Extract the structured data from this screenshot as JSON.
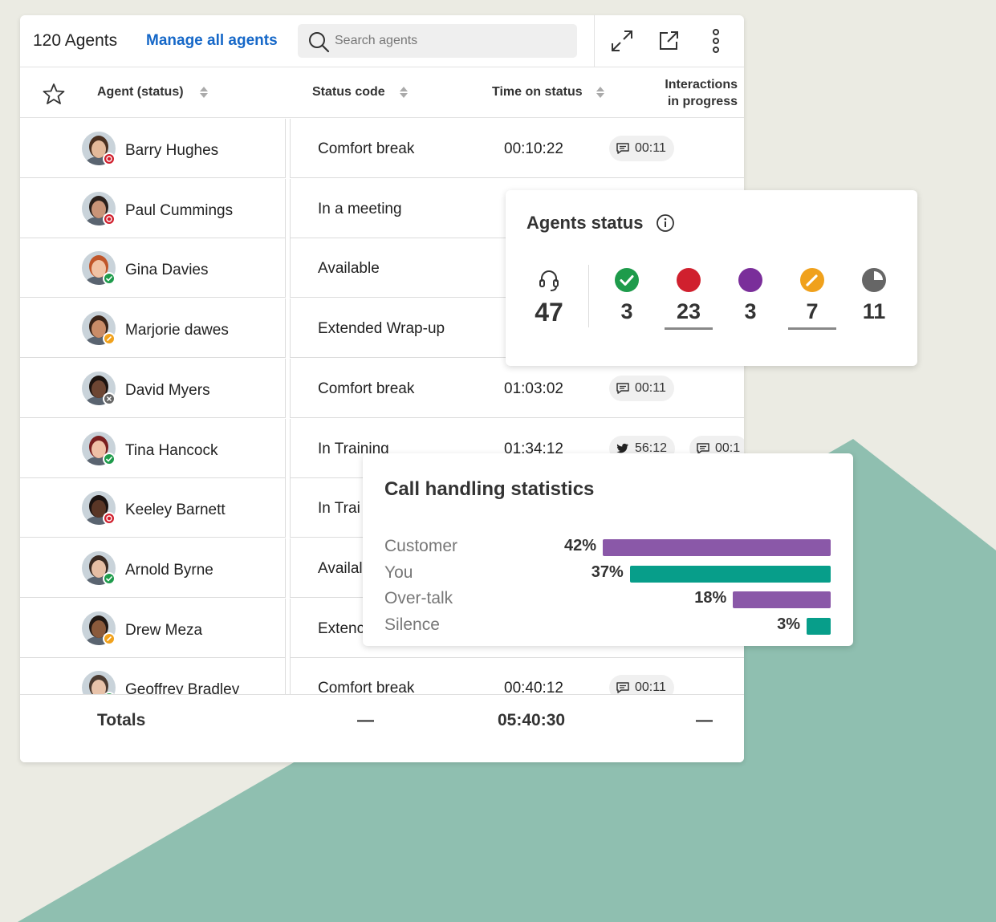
{
  "header": {
    "agent_count": "120 Agents",
    "manage_link": "Manage all agents",
    "search_placeholder": "Search agents"
  },
  "columns": {
    "agent": "Agent (status)",
    "status_code": "Status code",
    "time_on_status": "Time on status",
    "interactions_line1": "Interactions",
    "interactions_line2": "in progress"
  },
  "status_colors": {
    "busy": "#d0202e",
    "available": "#1e9b4b",
    "away": "#f0a11c",
    "offline": "#666666"
  },
  "rows": [
    {
      "name": "Barry Hughes",
      "status": "busy",
      "status_code": "Comfort break",
      "time": "00:10:22",
      "chip_icon": "chat-icon",
      "chip": "00:11",
      "skin": "#e3b99a",
      "hair": "#4a3020"
    },
    {
      "name": "Paul Cummings",
      "status": "busy",
      "status_code": "In a meeting",
      "time": "",
      "chip_icon": "",
      "chip": "",
      "skin": "#c99478",
      "hair": "#2a201c"
    },
    {
      "name": "Gina Davies",
      "status": "available",
      "status_code": "Available",
      "time": "",
      "chip_icon": "",
      "chip": "",
      "skin": "#f1c3a5",
      "hair": "#c0562a"
    },
    {
      "name": "Marjorie dawes",
      "status": "away",
      "status_code": "Extended Wrap-up",
      "time": "",
      "chip_icon": "",
      "chip": "",
      "skin": "#c98c68",
      "hair": "#3a2418"
    },
    {
      "name": "David Myers",
      "status": "offline",
      "status_code": "Comfort break",
      "time": "01:03:02",
      "chip_icon": "chat-icon",
      "chip": "00:11",
      "skin": "#6d4633",
      "hair": "#1c1410"
    },
    {
      "name": "Tina Hancock",
      "status": "available",
      "status_code": "In Training",
      "time": "01:34:12",
      "chip_icon": "twitter-icon",
      "chip": "56:12",
      "chip2": "00:1",
      "skin": "#efc0a6",
      "hair": "#7a1f1f"
    },
    {
      "name": "Keeley Barnett",
      "status": "busy",
      "status_code": "In Trai",
      "time": "",
      "chip_icon": "",
      "chip": "",
      "skin": "#5a3626",
      "hair": "#1a1210"
    },
    {
      "name": "Arnold Byrne",
      "status": "available",
      "status_code": "Availal",
      "time": "",
      "chip_icon": "",
      "chip": "",
      "skin": "#e6bea4",
      "hair": "#3a2a22"
    },
    {
      "name": "Drew Meza",
      "status": "away",
      "status_code": "Extenc",
      "time": "",
      "chip_icon": "",
      "chip": "",
      "skin": "#8a5a3c",
      "hair": "#201814"
    },
    {
      "name": "Geoffrey Bradley",
      "status": "available",
      "status_code": "Comfort break",
      "time": "00:40:12",
      "chip_icon": "chat-icon",
      "chip": "00:11",
      "skin": "#e8c3aa",
      "hair": "#4a3a30"
    }
  ],
  "totals": {
    "label": "Totals",
    "status_dash": "—",
    "time": "05:40:30",
    "interactions_dash": "—"
  },
  "agents_status": {
    "title": "Agents status",
    "total_icon": "headset-icon",
    "total": "47",
    "stats": [
      {
        "icon": "check-circle-icon",
        "color": "#1e9b4b",
        "value": "3",
        "underline": false
      },
      {
        "icon": "red-dot-icon",
        "color": "#d0202e",
        "value": "23",
        "underline": true
      },
      {
        "icon": "purple-dot-icon",
        "color": "#7a2e9a",
        "value": "3",
        "underline": false
      },
      {
        "icon": "pencil-circle-icon",
        "color": "#f0a11c",
        "value": "7",
        "underline": true
      },
      {
        "icon": "clock-circle-icon",
        "color": "#666666",
        "value": "11",
        "underline": false
      }
    ]
  },
  "call_handling": {
    "title": "Call handling statistics",
    "rows": [
      {
        "label": "Customer",
        "percent_label": "42%",
        "percent": 42,
        "color": "#8a58a8"
      },
      {
        "label": "You",
        "percent_label": "37%",
        "percent": 37,
        "color": "#079e8a"
      },
      {
        "label": "Over-talk",
        "percent_label": "18%",
        "percent": 18,
        "color": "#8a58a8"
      },
      {
        "label": "Silence",
        "percent_label": "3%",
        "percent": 3,
        "color": "#079e8a"
      }
    ]
  }
}
